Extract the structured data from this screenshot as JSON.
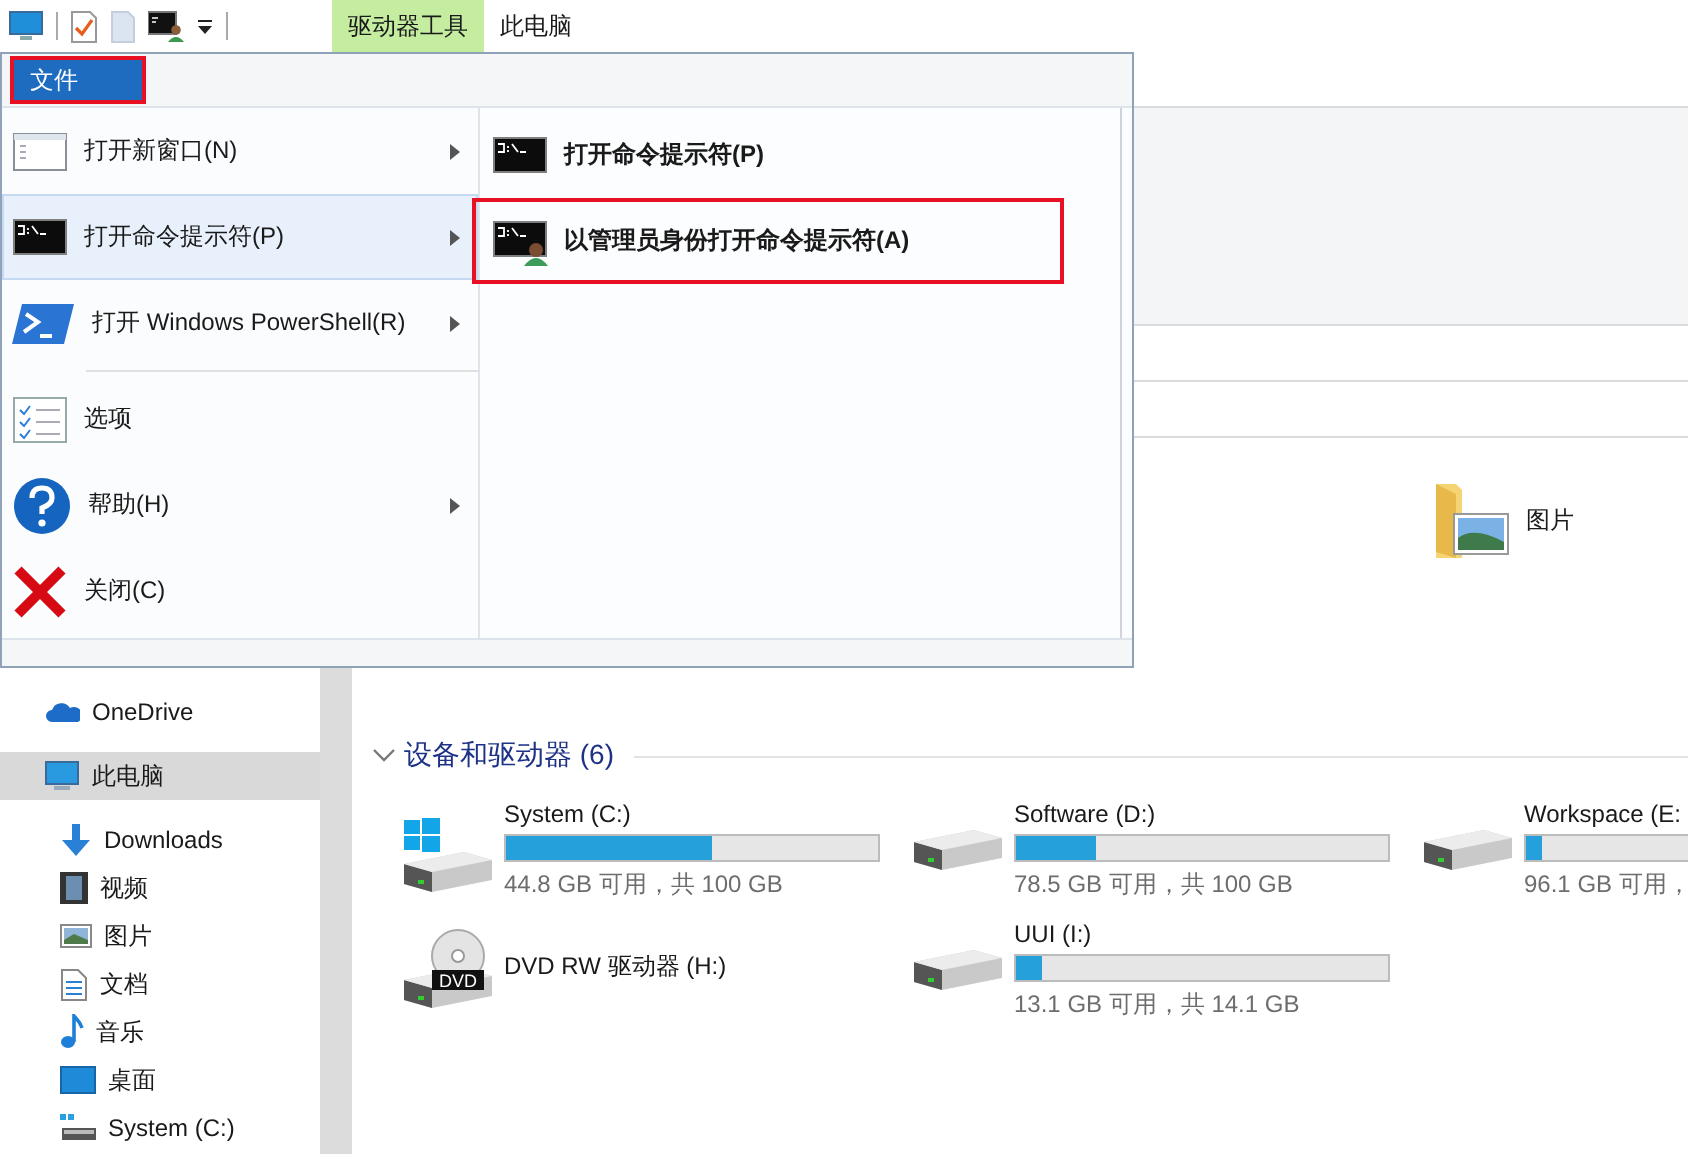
{
  "title_bar": {
    "tabs": [
      {
        "label": "驱动器工具",
        "selected": true
      },
      {
        "label": "此电脑",
        "selected": false
      }
    ]
  },
  "file_menu": {
    "button": {
      "label": "文件",
      "highlighted": true
    },
    "items": [
      {
        "kind": "window",
        "label": "打开新窗口(N)",
        "submenu": true,
        "selected": false
      },
      {
        "kind": "cmd",
        "label": "打开命令提示符(P)",
        "submenu": true,
        "selected": true
      },
      {
        "kind": "powershell",
        "label": "打开 Windows PowerShell(R)",
        "submenu": true,
        "selected": false
      },
      {
        "kind": "separator"
      },
      {
        "kind": "options",
        "label": "选项",
        "submenu": false,
        "selected": false
      },
      {
        "kind": "help",
        "label": "帮助(H)",
        "submenu": true,
        "selected": false
      },
      {
        "kind": "close",
        "label": "关闭(C)",
        "submenu": false,
        "selected": false
      }
    ],
    "submenu_items": [
      {
        "kind": "cmd",
        "label": "打开命令提示符(P)",
        "highlighted": false
      },
      {
        "kind": "cmd-admin",
        "label": "以管理员身份打开命令提示符(A)",
        "highlighted": true
      }
    ]
  },
  "sidebar": {
    "items": [
      {
        "kind": "onedrive",
        "label": "OneDrive",
        "selected": false
      },
      {
        "kind": "computer",
        "label": "此电脑",
        "selected": true,
        "children": [
          {
            "kind": "downloads",
            "label": "Downloads",
            "selected": false
          },
          {
            "kind": "videos",
            "label": "视频",
            "selected": false
          },
          {
            "kind": "pictures",
            "label": "图片",
            "selected": false
          },
          {
            "kind": "documents",
            "label": "文档",
            "selected": false
          },
          {
            "kind": "music",
            "label": "音乐",
            "selected": false
          },
          {
            "kind": "desktop",
            "label": "桌面",
            "selected": false
          },
          {
            "kind": "drive",
            "label": "System (C:)",
            "selected": false
          }
        ]
      }
    ]
  },
  "folders": [
    {
      "label": "图片"
    }
  ],
  "devices": {
    "title": "设备和驱动器 (6)",
    "expanded": true,
    "drives": [
      {
        "kind": "system",
        "name": "System (C:)",
        "level": 0.552,
        "free": "44.8 GB 可用，共 100 GB"
      },
      {
        "kind": "hdd",
        "name": "Software (D:)",
        "level": 0.215,
        "free": "78.5 GB 可用，共 100 GB"
      },
      {
        "kind": "hdd",
        "name": "Workspace (E:",
        "level": 0.039,
        "free": "96.1 GB 可用，"
      },
      {
        "kind": "dvd",
        "name": "DVD RW 驱动器 (H:)",
        "badge": "DVD"
      },
      {
        "kind": "hdd",
        "name": "UUI (I:)",
        "level": 0.071,
        "free": "13.1 GB 可用，共 14.1 GB"
      }
    ]
  }
}
